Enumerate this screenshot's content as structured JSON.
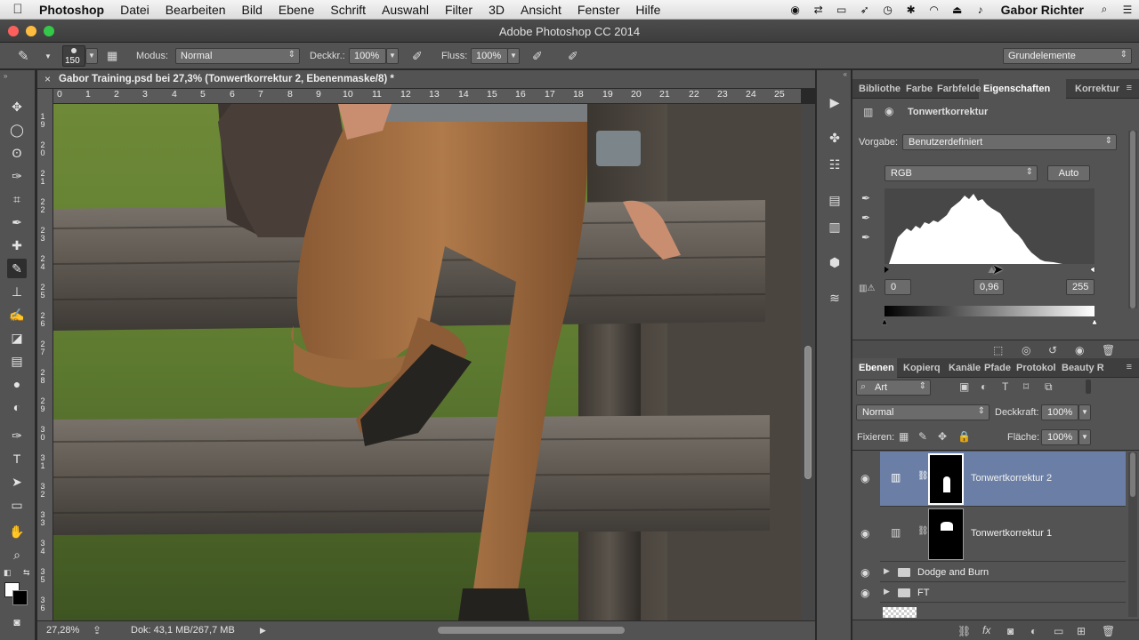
{
  "menubar": {
    "app": "Photoshop",
    "items": [
      "Datei",
      "Bearbeiten",
      "Bild",
      "Ebene",
      "Schrift",
      "Auswahl",
      "Filter",
      "3D",
      "Ansicht",
      "Fenster",
      "Hilfe"
    ],
    "user": "Gabor Richter",
    "status_icons": [
      "record-icon",
      "shuffle-icon",
      "display-icon",
      "send-icon",
      "history-icon",
      "bluetooth-icon",
      "wifi-icon",
      "eject-icon",
      "volume-icon"
    ]
  },
  "window": {
    "title": "Adobe Photoshop CC 2014"
  },
  "options": {
    "brush_size": "150",
    "mode_label": "Modus:",
    "mode_value": "Normal",
    "opacity_label": "Deckkr.:",
    "opacity_value": "100%",
    "flow_label": "Fluss:",
    "flow_value": "100%",
    "workspace": "Grundelemente"
  },
  "document": {
    "tab_title": "Gabor Training.psd bei 27,3% (Tonwertkorrektur 2, Ebenenmaske/8) *",
    "ruler_h": [
      "0",
      "1",
      "2",
      "3",
      "4",
      "5",
      "6",
      "7",
      "8",
      "9",
      "10",
      "11",
      "12",
      "13",
      "14",
      "15",
      "16",
      "17",
      "18",
      "19",
      "20",
      "21",
      "22",
      "23",
      "24",
      "25"
    ],
    "ruler_v": [
      "1\n9",
      "2\n0",
      "2\n1",
      "2\n2",
      "2\n3",
      "2\n4",
      "2\n5",
      "2\n6",
      "2\n7",
      "2\n8",
      "2\n9",
      "3\n0",
      "3\n1",
      "3\n2",
      "3\n3",
      "3\n4",
      "3\n5",
      "3\n6"
    ],
    "zoom": "27,28%",
    "doc_info": "Dok: 43,1 MB/267,7 MB"
  },
  "properties_tabs": [
    "Bibliothe",
    "Farbe",
    "Farbfelde",
    "Eigenschaften",
    "Korrektur"
  ],
  "properties": {
    "title": "Tonwertkorrektur",
    "preset_label": "Vorgabe:",
    "preset_value": "Benutzerdefiniert",
    "channel": "RGB",
    "auto_label": "Auto",
    "input_black": "0",
    "input_gamma": "0,96",
    "input_white": "255",
    "gamma_marker": 0.51
  },
  "layers_tabs": [
    "Ebenen",
    "Kopierq",
    "Kanäle",
    "Pfade",
    "Protokol",
    "Beauty R"
  ],
  "layers_panel": {
    "filter_kind": "Art",
    "blend_mode": "Normal",
    "opacity_label": "Deckkraft:",
    "opacity_value": "100%",
    "lock_label": "Fixieren:",
    "fill_label": "Fläche:",
    "fill_value": "100%",
    "layers": [
      {
        "name": "Tonwertkorrektur 2",
        "type": "adjustment",
        "selected": true
      },
      {
        "name": "Tonwertkorrektur 1",
        "type": "adjustment",
        "selected": false
      },
      {
        "name": "Dodge and Burn",
        "type": "group",
        "selected": false
      },
      {
        "name": "FT",
        "type": "group",
        "selected": false
      }
    ]
  },
  "colors": {
    "selected_layer": "#6b7fa6",
    "panel_bg": "#535353",
    "traffic_red": "#fc605c",
    "traffic_yellow": "#fdbc40",
    "traffic_green": "#34c84a"
  }
}
